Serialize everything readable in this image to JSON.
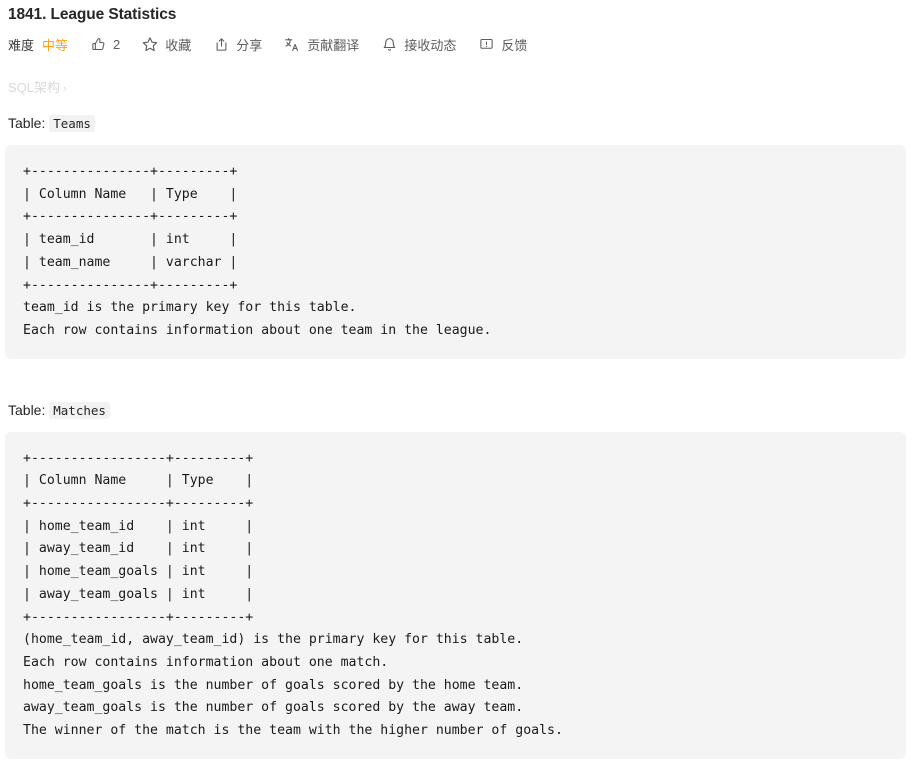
{
  "header": {
    "title": "1841. League Statistics"
  },
  "toolbar": {
    "difficulty_label": "难度",
    "difficulty_value": "中等",
    "items": [
      {
        "name": "like",
        "icon": "thumbs-up-icon",
        "label": "2"
      },
      {
        "name": "favorite",
        "icon": "star-icon",
        "label": "收藏"
      },
      {
        "name": "share",
        "icon": "share-icon",
        "label": "分享"
      },
      {
        "name": "translate",
        "icon": "translate-icon",
        "label": "贡献翻译"
      },
      {
        "name": "subscribe",
        "icon": "bell-icon",
        "label": "接收动态"
      },
      {
        "name": "feedback",
        "icon": "feedback-icon",
        "label": "反馈"
      }
    ]
  },
  "breadcrumb": {
    "label": "SQL架构",
    "separator": "›"
  },
  "sections": [
    {
      "heading_prefix": "Table:",
      "table_name": "Teams",
      "code": "+---------------+---------+\n| Column Name   | Type    |\n+---------------+---------+\n| team_id       | int     |\n| team_name     | varchar |\n+---------------+---------+\nteam_id is the primary key for this table.\nEach row contains information about one team in the league."
    },
    {
      "heading_prefix": "Table:",
      "table_name": "Matches",
      "code": "+-----------------+---------+\n| Column Name     | Type    |\n+-----------------+---------+\n| home_team_id    | int     |\n| away_team_id    | int     |\n| home_team_goals | int     |\n| away_team_goals | int     |\n+-----------------+---------+\n(home_team_id, away_team_id) is the primary key for this table.\nEach row contains information about one match.\nhome_team_goals is the number of goals scored by the home team.\naway_team_goals is the number of goals scored by the away team.\nThe winner of the match is the team with the higher number of goals."
    }
  ],
  "colors": {
    "difficulty_medium": "#ffa116",
    "code_background": "#f4f4f5",
    "text": "#262626",
    "muted": "#d9d9d9"
  }
}
